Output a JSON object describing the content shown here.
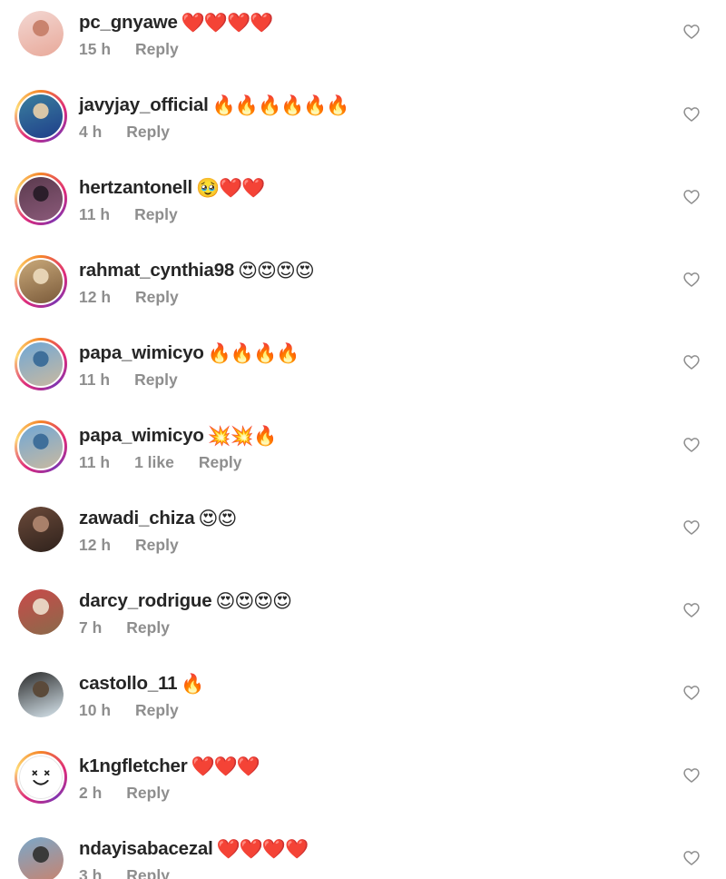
{
  "reply_label": "Reply",
  "comments": [
    {
      "username": "pc_gnyawe",
      "text": "❤️❤️❤️❤️",
      "time": "15 h",
      "likes": "",
      "story_ring": false,
      "avatar_colors": [
        "#f3d7d2",
        "#e8a99a",
        "#c9836e"
      ]
    },
    {
      "username": "javyjay_official",
      "text": "🔥🔥🔥🔥🔥🔥",
      "time": "4 h",
      "likes": "",
      "story_ring": true,
      "avatar_colors": [
        "#3a7f9e",
        "#1f3f8a",
        "#d8c6a8"
      ]
    },
    {
      "username": "hertzantonell",
      "text": "🥹❤️❤️",
      "time": "11 h",
      "likes": "",
      "story_ring": true,
      "avatar_colors": [
        "#5a3a4d",
        "#8b5a7a",
        "#2b1e2a"
      ]
    },
    {
      "username": "rahmat_cynthia98",
      "text": "😍😍😍😍",
      "time": "12 h",
      "likes": "",
      "story_ring": true,
      "avatar_colors": [
        "#c9a97a",
        "#7a5a3a",
        "#e6d3b4"
      ]
    },
    {
      "username": "papa_wimicyo",
      "text": "🔥🔥🔥🔥",
      "time": "11 h",
      "likes": "",
      "story_ring": true,
      "avatar_colors": [
        "#6fa7d6",
        "#c9b9a0",
        "#3f6f9a"
      ]
    },
    {
      "username": "papa_wimicyo",
      "text": "💥💥🔥",
      "time": "11 h",
      "likes": "1 like",
      "story_ring": true,
      "avatar_colors": [
        "#6fa7d6",
        "#c9b9a0",
        "#3f6f9a"
      ]
    },
    {
      "username": "zawadi_chiza",
      "text": "😍😍",
      "time": "12 h",
      "likes": "",
      "story_ring": false,
      "avatar_colors": [
        "#6b4a3a",
        "#2f221c",
        "#a8806a"
      ]
    },
    {
      "username": "darcy_rodrigue",
      "text": "😍😍😍😍",
      "time": "7 h",
      "likes": "",
      "story_ring": false,
      "avatar_colors": [
        "#c94a4a",
        "#8a6a4a",
        "#e7d2c0"
      ]
    },
    {
      "username": "castollo_11",
      "text": "🔥",
      "time": "10 h",
      "likes": "",
      "story_ring": false,
      "avatar_colors": [
        "#2a2a2a",
        "#d9e7ef",
        "#5b4a3a"
      ]
    },
    {
      "username": "k1ngfletcher",
      "text": "❤️❤️❤️",
      "time": "2 h",
      "likes": "",
      "story_ring": true,
      "avatar_colors": [
        "#ffffff",
        "#ffffff",
        "#ffffff"
      ],
      "avatar_face": true
    },
    {
      "username": "ndayisabacezal",
      "text": "❤️❤️❤️❤️",
      "time": "3 h",
      "likes": "",
      "story_ring": false,
      "avatar_colors": [
        "#7aa7c9",
        "#c9836e",
        "#3a3a3a"
      ]
    }
  ],
  "icons": {
    "like": "heart-outline-icon"
  }
}
